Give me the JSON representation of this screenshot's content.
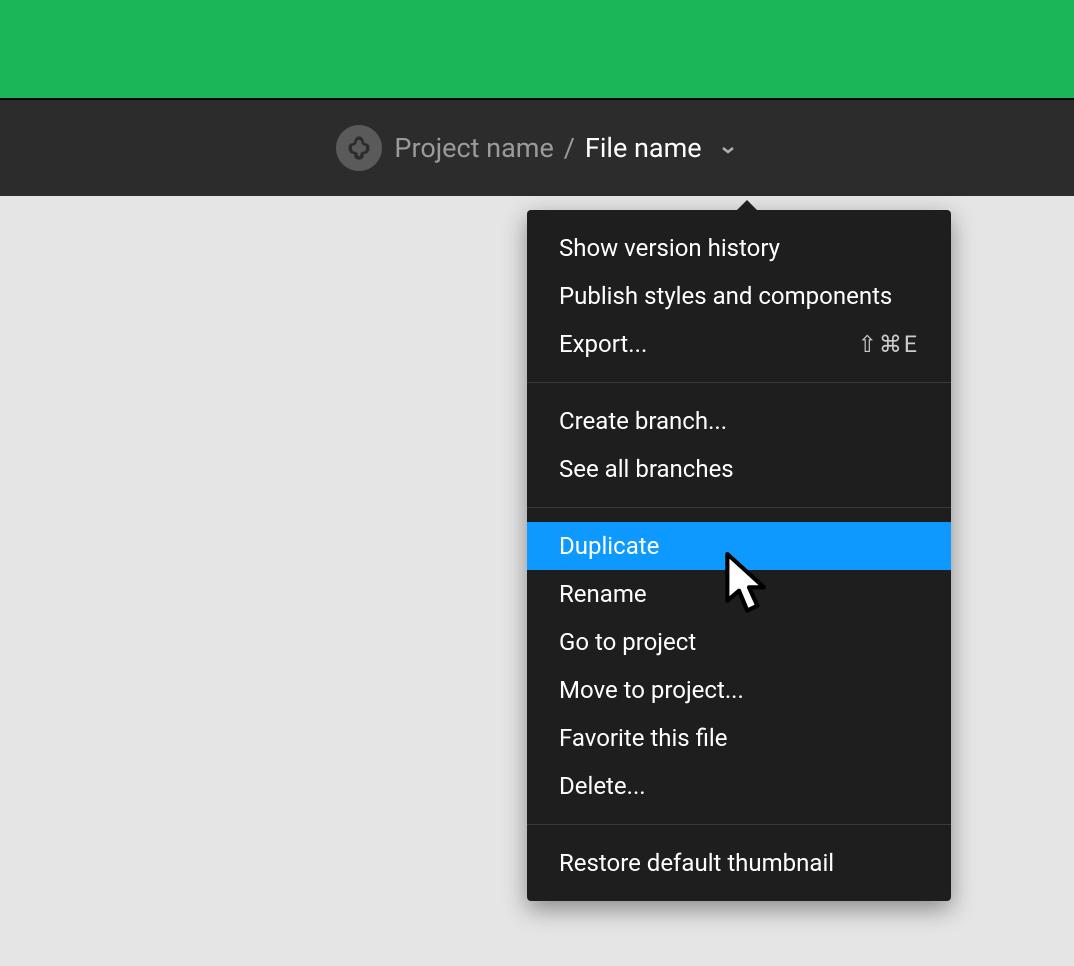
{
  "header": {
    "project_name": "Project name",
    "separator": "/",
    "file_name": "File name"
  },
  "menu": {
    "sections": [
      {
        "items": [
          {
            "label": "Show version history",
            "shortcut": ""
          },
          {
            "label": "Publish styles and components",
            "shortcut": ""
          },
          {
            "label": "Export...",
            "shortcut": "⇧⌘E"
          }
        ]
      },
      {
        "items": [
          {
            "label": "Create branch...",
            "shortcut": ""
          },
          {
            "label": "See all branches",
            "shortcut": ""
          }
        ]
      },
      {
        "items": [
          {
            "label": "Duplicate",
            "shortcut": "",
            "highlighted": true
          },
          {
            "label": "Rename",
            "shortcut": ""
          },
          {
            "label": "Go to project",
            "shortcut": ""
          },
          {
            "label": "Move to project...",
            "shortcut": ""
          },
          {
            "label": "Favorite this file",
            "shortcut": ""
          },
          {
            "label": "Delete...",
            "shortcut": ""
          }
        ]
      },
      {
        "items": [
          {
            "label": "Restore default thumbnail",
            "shortcut": ""
          }
        ]
      }
    ]
  }
}
